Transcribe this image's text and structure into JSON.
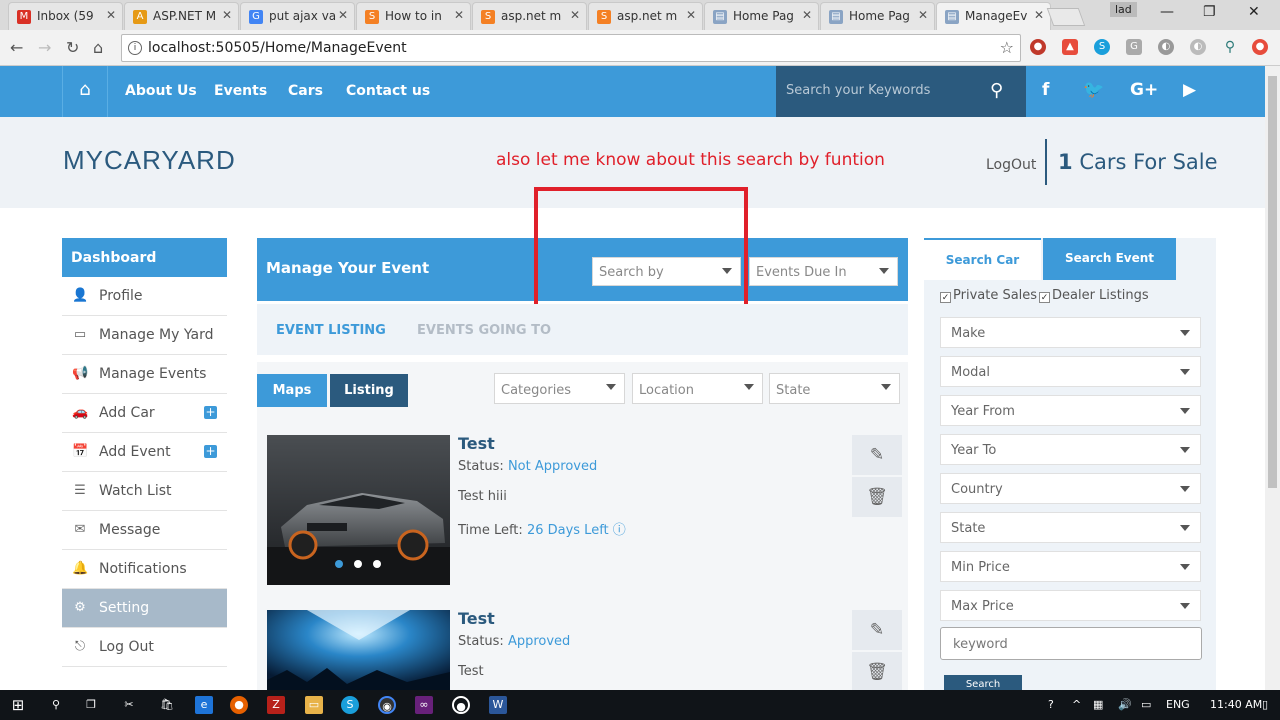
{
  "browser": {
    "tabs": [
      {
        "title": "Inbox (59",
        "icon": "gmail-icon",
        "color": "#d93025",
        "glyph": "M"
      },
      {
        "title": "ASP.NET M",
        "icon": "aspnet-icon",
        "color": "#e69a16",
        "glyph": "A"
      },
      {
        "title": "put ajax va",
        "icon": "google-icon",
        "color": "#4285f4",
        "glyph": "G"
      },
      {
        "title": "How to in",
        "icon": "stackoverflow-icon",
        "color": "#f48024",
        "glyph": "S"
      },
      {
        "title": "asp.net m",
        "icon": "stackoverflow-icon",
        "color": "#f48024",
        "glyph": "S"
      },
      {
        "title": "asp.net m",
        "icon": "stackoverflow-icon",
        "color": "#f48024",
        "glyph": "S"
      },
      {
        "title": "Home Pag",
        "icon": "page-icon",
        "color": "#8aa4c4",
        "glyph": "▤"
      },
      {
        "title": "Home Pag",
        "icon": "page-icon",
        "color": "#8aa4c4",
        "glyph": "▤"
      },
      {
        "title": "ManageEv",
        "icon": "page-icon",
        "color": "#8aa4c4",
        "glyph": "▤"
      }
    ],
    "profile_label": "lad",
    "url": "localhost:50505/Home/ManageEvent"
  },
  "site": {
    "nav": [
      "About Us",
      "Events",
      "Cars",
      "Contact us"
    ],
    "search_placeholder": "Search your Keywords",
    "logo": "MYCARYARD",
    "annotation": "also let me know about this search by funtion",
    "logout": "LogOut",
    "cars_count": "1",
    "cars_label": "Cars For Sale"
  },
  "sidebar": {
    "title": "Dashboard",
    "items": [
      {
        "label": "Profile",
        "icon": "user-icon",
        "glyph": "👤"
      },
      {
        "label": "Manage My Yard",
        "icon": "monitor-icon",
        "glyph": "🖥"
      },
      {
        "label": "Manage Events",
        "icon": "megaphone-icon",
        "glyph": "📢"
      },
      {
        "label": "Add Car",
        "icon": "car-icon",
        "glyph": "🚗"
      },
      {
        "label": "Add Event",
        "icon": "calendar-icon",
        "glyph": "📅"
      },
      {
        "label": "Watch List",
        "icon": "list-icon",
        "glyph": "☰"
      },
      {
        "label": "Message",
        "icon": "envelope-icon",
        "glyph": "✉"
      },
      {
        "label": "Notifications",
        "icon": "bell-icon",
        "glyph": "🔔"
      },
      {
        "label": "Setting",
        "icon": "gear-icon",
        "glyph": "⚙"
      },
      {
        "label": "Log Out",
        "icon": "logout-icon",
        "glyph": "⎋"
      }
    ]
  },
  "manage": {
    "title": "Manage Your Event",
    "search_by": "Search by",
    "events_due": "Events Due In",
    "tab_listing": "EVENT LISTING",
    "tab_going": "EVENTS GOING TO",
    "btn_maps": "Maps",
    "btn_listing": "Listing",
    "filter_categories": "Categories",
    "filter_location": "Location",
    "filter_state": "State"
  },
  "events": [
    {
      "title": "Test",
      "status_label": "Status:",
      "status": "Not Approved",
      "desc": "Test hiii",
      "time_label": "Time Left:",
      "time": "26 Days Left"
    },
    {
      "title": "Test",
      "status_label": "Status:",
      "status": "Approved",
      "desc": "Test"
    }
  ],
  "search_panel": {
    "tab_car": "Search Car",
    "tab_event": "Search Event",
    "private_sales": "Private Sales",
    "dealer_listings": "Dealer Listings",
    "selects": [
      "Make",
      "Modal",
      "Year From",
      "Year To",
      "Country",
      "State",
      "Min Price",
      "Max Price"
    ],
    "keyword_placeholder": "keyword",
    "search_button": "Search"
  },
  "taskbar": {
    "language": "ENG",
    "time": "11:40 AM"
  },
  "colors": {
    "primary": "#3d9ad9",
    "dark": "#2b5a7e",
    "annotation": "#e0202a"
  }
}
